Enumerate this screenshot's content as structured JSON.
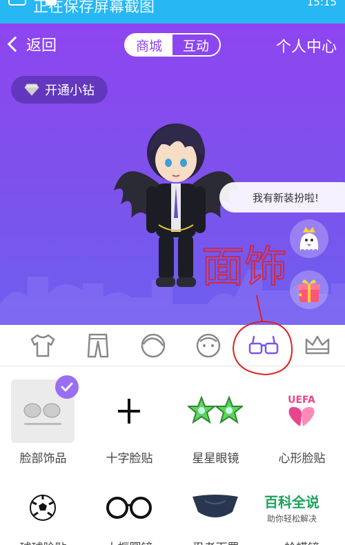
{
  "status_bar": {
    "notification": "正在保存屏幕截图",
    "time": "15:15"
  },
  "header": {
    "back_label": "返回",
    "tabs": [
      {
        "label": "商城",
        "active": true
      },
      {
        "label": "互动",
        "active": false
      }
    ],
    "profile_label": "个人中心"
  },
  "vip_button": {
    "label": "开通小钻",
    "icon": "diamond-icon"
  },
  "speech_bubble": {
    "text": "我有新装扮啦!"
  },
  "handwriting": {
    "text": "面饰"
  },
  "category_tabs": [
    {
      "name": "shirt-icon"
    },
    {
      "name": "pants-icon"
    },
    {
      "name": "hair-icon"
    },
    {
      "name": "face-icon"
    },
    {
      "name": "glasses-icon",
      "active": true
    },
    {
      "name": "crown-icon"
    }
  ],
  "items": [
    {
      "label": "脸部饰品",
      "selected": true,
      "icon": "face-accessory-icon"
    },
    {
      "label": "十字脸贴",
      "icon": "cross-sticker-icon"
    },
    {
      "label": "星星眼镜",
      "icon": "star-glasses-icon"
    },
    {
      "label": "心形脸贴",
      "icon": "heart-sticker-icon",
      "badge": "UEFA"
    },
    {
      "label": "球球脸贴",
      "icon": "soccer-ball-icon"
    },
    {
      "label": "大框圆镜",
      "icon": "round-glasses-icon"
    },
    {
      "label": "忍者面罩",
      "icon": "ninja-mask-icon"
    },
    {
      "label": "蛤蟆镜",
      "icon": "sunglasses-icon"
    }
  ],
  "watermark": {
    "title": "百科全说",
    "subtitle": "助你轻松解决"
  },
  "colors": {
    "primary": "#8e45f0",
    "accent": "#9a6df2",
    "status_bar": "#27b7f2",
    "annotation": "#e02020"
  }
}
